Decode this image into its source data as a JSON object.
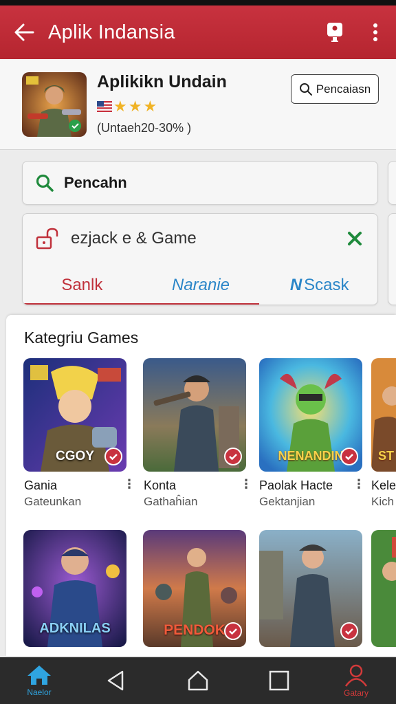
{
  "appbar": {
    "title": "Aplik Indansia"
  },
  "app": {
    "name": "Aplikikn Undain",
    "subtitle": "(Untaeh20-30% )",
    "search_button": "Pencaiasn",
    "stars": 3
  },
  "search": {
    "value": "Pencahn"
  },
  "filter": {
    "text": "ezjack e & Game",
    "tabs": [
      "Sanlk",
      "Naranie",
      "Scask"
    ],
    "active_tab": 0
  },
  "section": {
    "title": "Kategriu Games"
  },
  "games_row1": [
    {
      "name": "Gania",
      "subtitle": "Gateunkan",
      "banner": "CGOY"
    },
    {
      "name": "Konta",
      "subtitle": "Gathaĥian",
      "banner": ""
    },
    {
      "name": "Paolak Hacte",
      "subtitle": "Gektanjian",
      "banner": "NENANDIN"
    },
    {
      "name": "Kele",
      "subtitle": "Kich",
      "banner": "ST"
    }
  ],
  "games_row2": [
    {
      "banner": "ADKNILAS"
    },
    {
      "banner": "PENDOK"
    },
    {
      "banner": ""
    },
    {
      "banner": ""
    }
  ],
  "navbar": {
    "home_label": "Naelor",
    "profile_label": "Gatary"
  },
  "colors": {
    "primary": "#c0313b",
    "accent": "#2b86c8",
    "search_icon": "#1f8a3c",
    "close_icon": "#1f8a3c"
  }
}
